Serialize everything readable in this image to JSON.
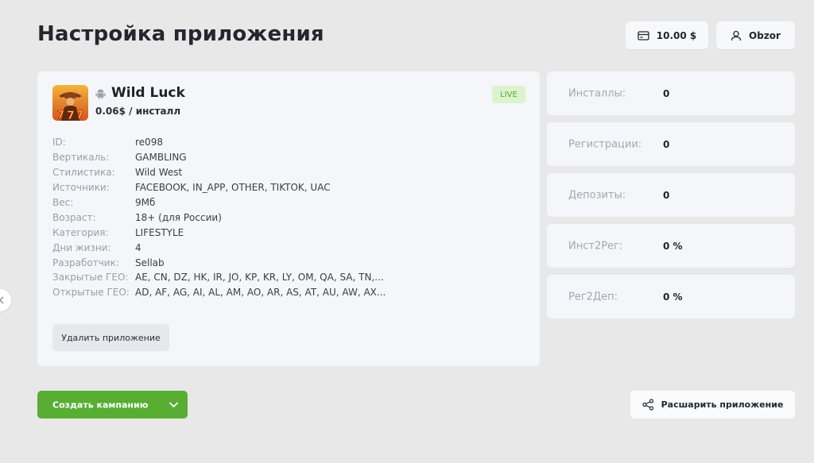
{
  "header": {
    "title": "Настройка приложения",
    "balance": "10.00 $",
    "username": "Obzor"
  },
  "app": {
    "name": "Wild Luck",
    "price": "0.06$ / инсталл",
    "status": "LIVE",
    "platform_icon": "android-icon",
    "properties": [
      {
        "label": "ID:",
        "value": "re098"
      },
      {
        "label": "Вертикаль:",
        "value": "GAMBLING"
      },
      {
        "label": "Стилистика:",
        "value": "Wild West"
      },
      {
        "label": "Источники:",
        "value": "FACEBOOK, IN_APP, OTHER, TIKTOK, UAC"
      },
      {
        "label": "Вес:",
        "value": "9Мб"
      },
      {
        "label": "Возраст:",
        "value": "18+ (для России)"
      },
      {
        "label": "Категория:",
        "value": "LIFESTYLE"
      },
      {
        "label": "Дни жизни:",
        "value": "4"
      },
      {
        "label": "Разработчик:",
        "value": "Sellab"
      },
      {
        "label": "Закрытые ГЕО:",
        "value": "AE, CN, DZ, HK, IR, JO, KP, KR, LY, OM, QA, SA, TN,..."
      },
      {
        "label": "Открытые ГЕО:",
        "value": "AD, AF, AG, AI, AL, AM, AO, AR, AS, AT, AU, AW, AX..."
      }
    ],
    "delete_label": "Удалить приложение"
  },
  "stats": [
    {
      "label": "Инсталлы:",
      "value": "0"
    },
    {
      "label": "Регистрации:",
      "value": "0"
    },
    {
      "label": "Депозиты:",
      "value": "0"
    },
    {
      "label": "Инст2Рег:",
      "value": "0 %"
    },
    {
      "label": "Рег2Деп:",
      "value": "0 %"
    }
  ],
  "actions": {
    "create_campaign": "Создать кампанию",
    "share_app": "Расшарить приложение"
  },
  "colors": {
    "accent_green": "#57ae33",
    "live_badge_bg": "#dcf3cf",
    "live_badge_text": "#5aac2c",
    "page_bg": "#e8e8e8",
    "card_bg": "#f5f6f9"
  }
}
